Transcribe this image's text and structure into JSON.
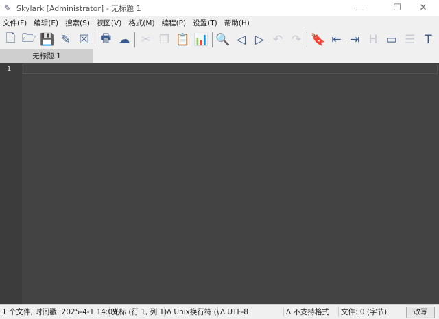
{
  "title": {
    "text": "Skylark [Administrator] - 无标题 1",
    "minimize": "—",
    "maximize": "☐",
    "close": "✕"
  },
  "menu": [
    "文件(F)",
    "编辑(E)",
    "搜索(S)",
    "视图(V)",
    "格式(M)",
    "编程(P)",
    "设置(T)",
    "帮助(H)"
  ],
  "toolbar": [
    {
      "icon": "new-file-icon",
      "g": "🗋",
      "dis": false
    },
    {
      "icon": "open-folder-icon",
      "g": "🗁",
      "dis": false
    },
    {
      "icon": "save-icon",
      "g": "💾",
      "dis": true
    },
    {
      "icon": "save-as-icon",
      "g": "✎",
      "dis": false
    },
    {
      "icon": "close-file-icon",
      "g": "☒",
      "dis": false
    },
    {
      "sep": true
    },
    {
      "icon": "print-icon",
      "g": "🖶",
      "dis": false
    },
    {
      "icon": "cloud-icon",
      "g": "☁",
      "dis": false
    },
    {
      "sep": true
    },
    {
      "icon": "cut-icon",
      "g": "✂",
      "dis": true
    },
    {
      "icon": "copy-icon",
      "g": "❐",
      "dis": true
    },
    {
      "icon": "paste-icon",
      "g": "📋",
      "dis": false
    },
    {
      "icon": "clipboard-icon",
      "g": "📊",
      "dis": false
    },
    {
      "sep": true
    },
    {
      "icon": "search-icon",
      "g": "🔍",
      "dis": false
    },
    {
      "icon": "prev-icon",
      "g": "◁",
      "dis": false
    },
    {
      "icon": "next-icon",
      "g": "▷",
      "dis": false
    },
    {
      "icon": "undo-icon",
      "g": "↶",
      "dis": true
    },
    {
      "icon": "redo-icon",
      "g": "↷",
      "dis": true
    },
    {
      "sep": true
    },
    {
      "icon": "bookmark-icon",
      "g": "🔖",
      "dis": false
    },
    {
      "icon": "indent-left-icon",
      "g": "⇤",
      "dis": false
    },
    {
      "icon": "indent-right-icon",
      "g": "⇥",
      "dis": false
    },
    {
      "icon": "hex-icon",
      "g": "H",
      "dis": true
    },
    {
      "icon": "drive-icon",
      "g": "▭",
      "dis": false
    },
    {
      "icon": "list-icon",
      "g": "☰",
      "dis": true
    },
    {
      "icon": "text-icon",
      "g": "T",
      "dis": false
    }
  ],
  "tab": {
    "label": "无标题 1"
  },
  "editor": {
    "line_number": "1"
  },
  "status": {
    "files": "1 个文件, 时间戳: 2025-4-1 14:09",
    "cursor": "光标 (行 1, 列 1)",
    "eol": "∆ Unix换行符 (\\",
    "encoding": "∆ UTF-8",
    "unsupported": "∆ 不支持格式",
    "size": "文件: 0 (字节)",
    "mode": "改写"
  }
}
